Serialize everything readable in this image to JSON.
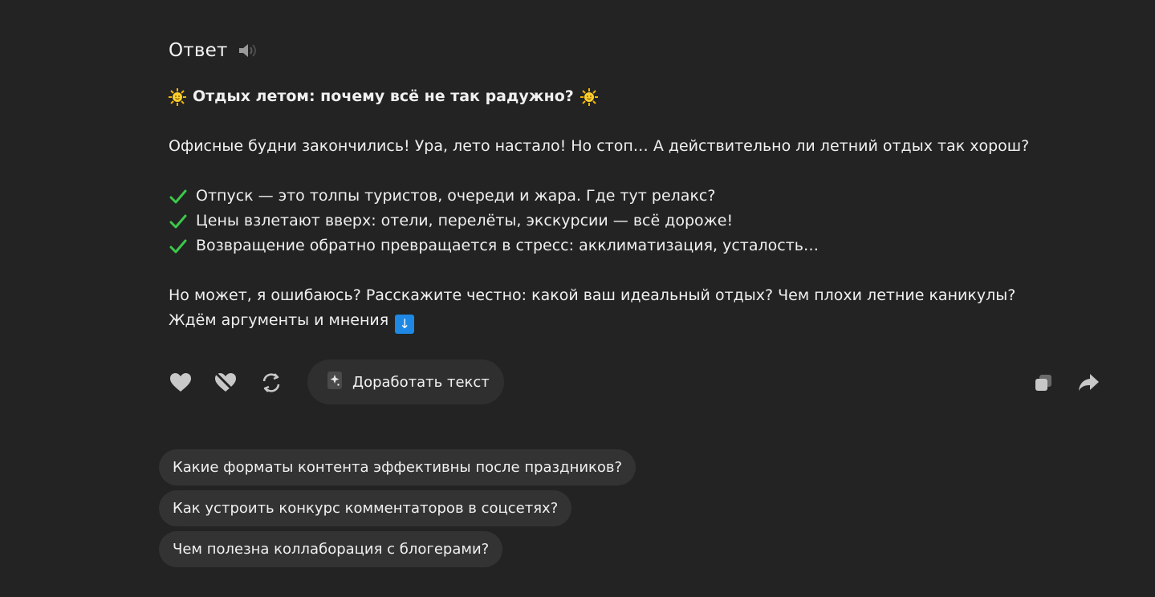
{
  "answer": {
    "title": "Ответ",
    "speaker_icon": "speaker-icon"
  },
  "message": {
    "heading": "Отдых летом: почему всё не так радужно?",
    "intro": "Офисные будни закончились! Ура, лето настало! Но стоп… А действительно ли летний отдых так хорош?",
    "points": [
      "Отпуск — это толпы туристов, очереди и жара. Где тут релакс?",
      "Цены взлетают вверх: отели, перелёты, экскурсии — всё дороже!",
      "Возвращение обратно превращается в стресс: акклиматизация, усталость…"
    ],
    "question": "Но может, я ошибаюсь? Расскажите честно: какой ваш идеальный отдых? Чем плохи летние каникулы?",
    "closing": "Ждём аргументы и мнения",
    "closing_emoji": "↓"
  },
  "actions": {
    "like_icon": "heart-icon",
    "dislike_icon": "broken-heart-icon",
    "regenerate_icon": "refresh-icon",
    "improve_label": "Доработать текст",
    "copy_icon": "copy-icon",
    "share_icon": "share-icon"
  },
  "suggestions": [
    "Какие форматы контента эффективны после праздников?",
    "Как устроить конкурс комментаторов в соцсетях?",
    "Чем полезна коллаборация с блогерами?"
  ],
  "colors": {
    "background": "#232323",
    "chip_background": "#333333",
    "check_green": "#3cc84a",
    "emoji_blue": "#1e88e5"
  }
}
